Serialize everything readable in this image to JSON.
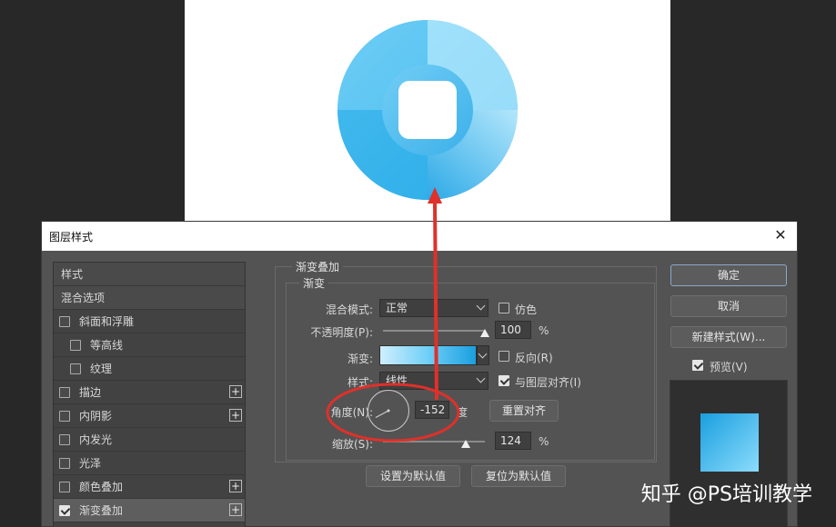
{
  "dialog": {
    "title": "图层样式",
    "close_glyph": "✕"
  },
  "style_list": {
    "header": "样式",
    "blend_options": "混合选项",
    "items": [
      {
        "label": "斜面和浮雕",
        "checked": false,
        "indent": false,
        "plus": false
      },
      {
        "label": "等高线",
        "checked": false,
        "indent": true,
        "plus": false
      },
      {
        "label": "纹理",
        "checked": false,
        "indent": true,
        "plus": false
      },
      {
        "label": "描边",
        "checked": false,
        "indent": false,
        "plus": true
      },
      {
        "label": "内阴影",
        "checked": false,
        "indent": false,
        "plus": true
      },
      {
        "label": "内发光",
        "checked": false,
        "indent": false,
        "plus": false
      },
      {
        "label": "光泽",
        "checked": false,
        "indent": false,
        "plus": false
      },
      {
        "label": "颜色叠加",
        "checked": false,
        "indent": false,
        "plus": true
      },
      {
        "label": "渐变叠加",
        "checked": true,
        "indent": false,
        "plus": true
      }
    ]
  },
  "panel": {
    "group_title": "渐变叠加",
    "subgroup_title": "渐变",
    "blend_mode_label": "混合模式:",
    "blend_mode_value": "正常",
    "dither_label": "仿色",
    "opacity_label": "不透明度(P):",
    "opacity_value": "100",
    "percent": "%",
    "gradient_label": "渐变:",
    "reverse_label": "反向(R)",
    "style_label": "样式:",
    "style_value": "线性",
    "align_label": "与图层对齐(I)",
    "angle_label": "角度(N):",
    "angle_value": "-152",
    "degree_unit": "度",
    "reset_align_button": "重置对齐",
    "scale_label": "缩放(S):",
    "scale_value": "124",
    "scale_percent": "%",
    "set_default_button": "设置为默认值",
    "reset_default_button": "复位为默认值"
  },
  "right": {
    "ok_button": "确定",
    "cancel_button": "取消",
    "new_style_button": "新建样式(W)...",
    "preview_label": "预览(V)"
  },
  "watermark": "知乎 @PS培训教学",
  "colors": {
    "accent_red": "#e0302a",
    "gradient_light": "#cfefff",
    "gradient_dark": "#1a9fe0"
  }
}
